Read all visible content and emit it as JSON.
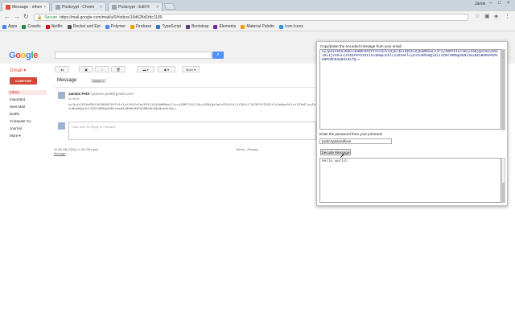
{
  "browser": {
    "tabs": [
      {
        "title": "Message - ethereo",
        "color": "#dd4b39"
      },
      {
        "title": "Postcrypt - Chrom",
        "color": "#9aa5b1"
      },
      {
        "title": "Postcrypt - Edit R",
        "color": "#9aa5b1"
      }
    ],
    "user": "Jamie",
    "secure_label": "Secure",
    "url": "https://mail.google.com/mail/u/0/#inbox/15d628d1fdc1189",
    "bookmarks": [
      {
        "label": "Apps",
        "color": "#4285f4"
      },
      {
        "label": "Coseils",
        "color": "#1e8e3e"
      },
      {
        "label": "Netflix",
        "color": "#e50914"
      },
      {
        "label": "Rocket and Epi",
        "color": "#555555"
      },
      {
        "label": "Polymer",
        "color": "#4285f4"
      },
      {
        "label": "Firebase",
        "color": "#ffa000"
      },
      {
        "label": "TypeScript",
        "color": "#3178c6"
      },
      {
        "label": "Bootstrap",
        "color": "#563d7c"
      },
      {
        "label": "Elements",
        "color": "#7b1fa2"
      },
      {
        "label": "Material Palette",
        "color": "#ff9800"
      },
      {
        "label": "Icon Icons",
        "color": "#2196f3"
      }
    ]
  },
  "gmail": {
    "logo": "Google",
    "label": "Gmail ▾",
    "compose": "COMPOSE",
    "nav": [
      "Inbox",
      "Important",
      "Sent Mail",
      "Drafts",
      "Computer Co",
      "Journal",
      "More ▾"
    ],
    "toolbar": [
      "◂◂",
      "▣",
      "!",
      "🗑",
      "▬ ▾",
      "◆ ▾",
      "More ▾"
    ],
    "message_title": "Message",
    "tag": "Inbox ×",
    "sender_name": "Jamies Petit",
    "sender_email": "<jamesc.petit@gmail.com>",
    "to_me": "to me ▾",
    "body": "eyJpdiI6IkxRSUl4UHBhSF9tTzIsInYiOjEsIml0ZXIiOjEwMDAwLCJrcyI6MTI4LCJ0cyI6NjQsIm1vZGUiOiJjY20iLCJhZGF0YSI6IiIsImNpcGhlciI6ImFlcyIsInNhbHQiOiJJZ0Y1MDNpOGNiYmxBZzB0MnM4Pk5RMnNhOXpNdz0ifQ==",
    "reply_placeholder": "Click here to Reply or Forward",
    "storage": "11.65 GB (78%) of 15 GB used",
    "manage": "Manage",
    "terms": "Terms - Privacy"
  },
  "popup": {
    "label_cipher": "Copy/paste the encoded message from your email:",
    "ciphertext": "eyJpdiI6IkxRSUl4UHBhSF9tTzIsInYiOjEsIml0ZXIiOjEwMDAwLCJrcyI6MTI4LCJ0cyI6NjQsIm1vZGUiOiJjY20iLCJhZGF0YSI6IiIsImNpcGhlciI6ImFlcyIsInNhbHQiOiJJZ0Y1MDNpOGNiYmxBZzB0MnM4Pk5RMnNhOXpNdz0ifQ==",
    "label_password": "Enter the password from your postcard:",
    "password": "postcryptsendlove",
    "decode_button": "Decode Message",
    "plaintext": "Hello world!"
  }
}
